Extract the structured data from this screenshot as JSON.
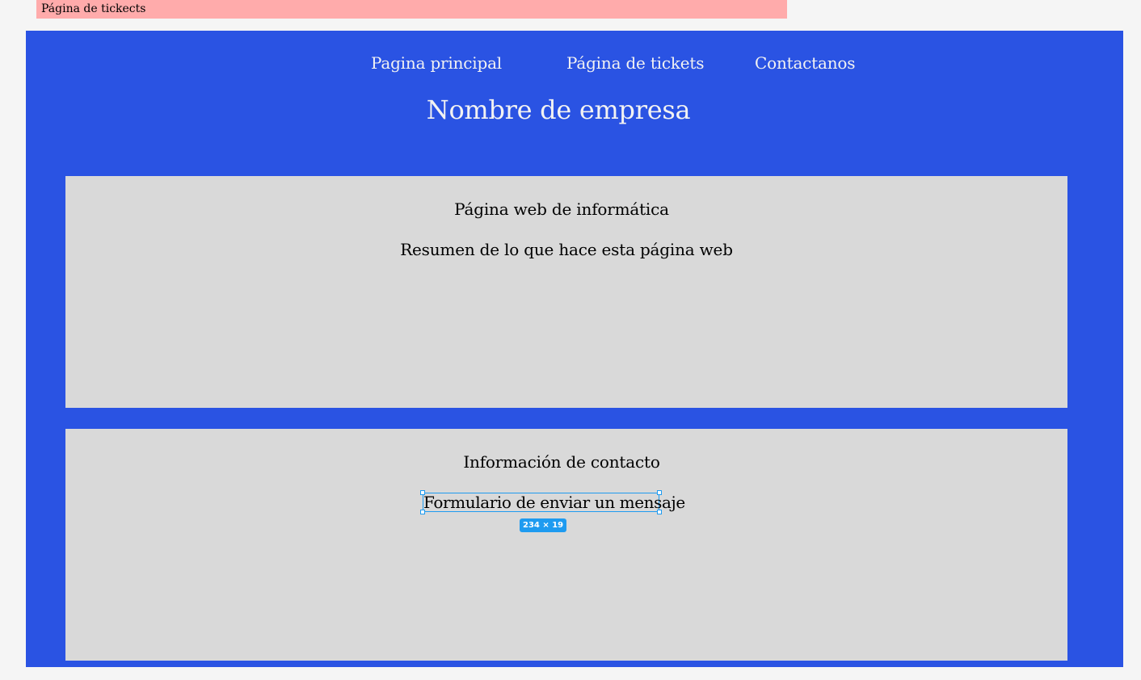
{
  "frame_label": "Página de tickects",
  "colors": {
    "frame_background": "#2a53e3",
    "card_background": "#d9d9d9",
    "label_background": "#ffabab",
    "selection": "#1e9bf0",
    "canvas": "#f5f5f5"
  },
  "nav": {
    "items": [
      {
        "label": "Pagina principal"
      },
      {
        "label": "Página de tickets"
      },
      {
        "label": "Contactanos"
      }
    ]
  },
  "header": {
    "company_name": "Nombre de empresa"
  },
  "cards": [
    {
      "title": "Página web de informática",
      "body": "Resumen de lo que hace  esta página web"
    },
    {
      "title": "Información de contacto",
      "body": "Formulario de enviar un mensaje"
    }
  ],
  "selection": {
    "size_badge": "234 × 19"
  }
}
